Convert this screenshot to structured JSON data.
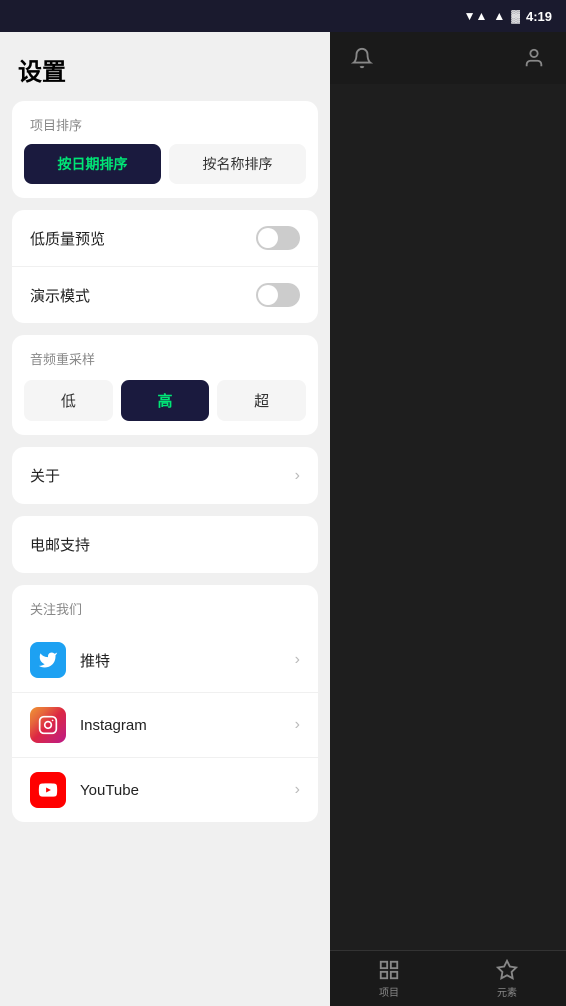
{
  "status_bar": {
    "time": "4:19",
    "wifi": "▼▲",
    "signal": "▲",
    "battery": "🔋"
  },
  "settings": {
    "title": "设置",
    "sort_section_label": "项目排序",
    "sort_by_date_label": "按日期排序",
    "sort_by_name_label": "按名称排序",
    "sort_active": "date",
    "toggle_section": {
      "low_quality_label": "低质量预览",
      "low_quality_on": false,
      "demo_mode_label": "演示模式",
      "demo_mode_on": false
    },
    "resample_section": {
      "label": "音频重采样",
      "options": [
        "低",
        "高",
        "超"
      ],
      "active": "高"
    },
    "about_label": "关于",
    "email_label": "电邮支持",
    "follow_us": {
      "label": "关注我们",
      "items": [
        {
          "name": "推特",
          "platform": "twitter"
        },
        {
          "name": "Instagram",
          "platform": "instagram"
        },
        {
          "name": "YouTube",
          "platform": "youtube"
        }
      ]
    }
  },
  "bottom_nav": {
    "items": [
      {
        "label": "项目",
        "icon": "grid"
      },
      {
        "label": "元素",
        "icon": "layers"
      }
    ]
  }
}
